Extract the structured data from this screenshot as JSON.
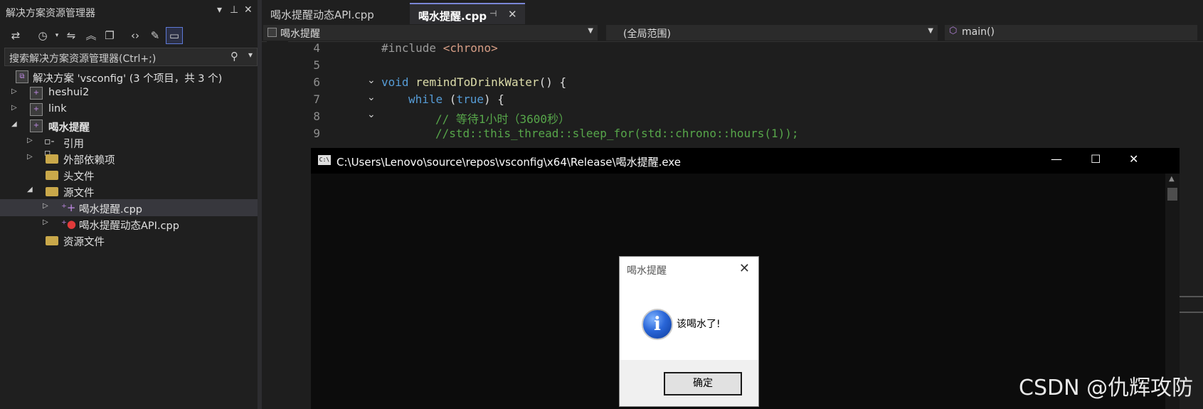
{
  "solution_explorer": {
    "title": "解决方案资源管理器",
    "search_placeholder": "搜索解决方案资源管理器(Ctrl+;)",
    "tree": [
      {
        "label": "解决方案 'vsconfig' (3 个项目，共 3 个)",
        "bold": false
      },
      {
        "label": "heshui2",
        "bold": false
      },
      {
        "label": "link",
        "bold": false
      },
      {
        "label": "喝水提醒",
        "bold": true
      },
      {
        "label": "引用",
        "bold": false
      },
      {
        "label": "外部依赖项",
        "bold": false
      },
      {
        "label": "头文件",
        "bold": false
      },
      {
        "label": "源文件",
        "bold": false
      },
      {
        "label": "喝水提醒.cpp",
        "bold": false
      },
      {
        "label": "喝水提醒动态API.cpp",
        "bold": false
      },
      {
        "label": "资源文件",
        "bold": false
      }
    ]
  },
  "editor": {
    "tabs": [
      {
        "label": "喝水提醒动态API.cpp",
        "active": false
      },
      {
        "label": "喝水提醒.cpp",
        "active": true
      }
    ],
    "nav": {
      "project": "喝水提醒",
      "scope": "(全局范围)",
      "member": "main()"
    },
    "line_numbers": [
      "4",
      "5",
      "6",
      "7",
      "8",
      "9"
    ],
    "code": {
      "l4_pp": "#include ",
      "l4_inc": "<chrono>",
      "l6_kw": "void ",
      "l6_fn": "remindToDrinkWater",
      "l6_rest": "() {",
      "l7_kw": "while ",
      "l7_p1": "(",
      "l7_kw2": "true",
      "l7_p2": ") {",
      "l8_cm": "// 等待1小时（3600秒）",
      "l9_cm": "//std::this_thread::sleep_for(std::chrono::hours(1));"
    }
  },
  "console": {
    "title": "C:\\Users\\Lenovo\\source\\repos\\vsconfig\\x64\\Release\\喝水提醒.exe",
    "minimize": "—",
    "maximize": "☐",
    "close": "✕"
  },
  "message_box": {
    "title": "喝水提醒",
    "message": "该喝水了!",
    "ok_label": "确定"
  },
  "watermark": "CSDN @仇辉攻防"
}
